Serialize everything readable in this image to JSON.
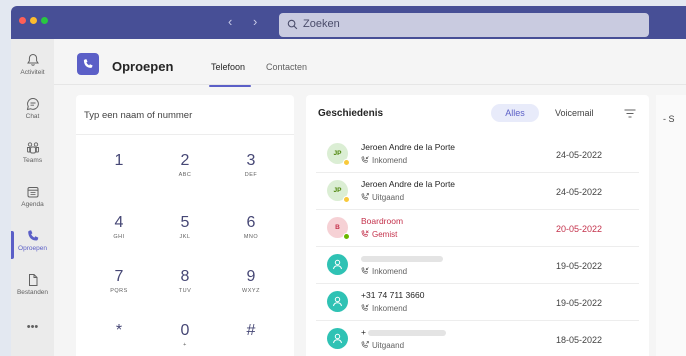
{
  "titlebar": {
    "search_placeholder": "Zoeken",
    "back_icon": "chevron-left-icon",
    "forward_icon": "chevron-right-icon"
  },
  "rail": {
    "items": [
      {
        "label": "Activiteit",
        "icon": "bell-icon"
      },
      {
        "label": "Chat",
        "icon": "chat-icon"
      },
      {
        "label": "Teams",
        "icon": "teams-icon"
      },
      {
        "label": "Agenda",
        "icon": "calendar-icon"
      },
      {
        "label": "Oproepen",
        "icon": "phone-icon",
        "active": true
      },
      {
        "label": "Bestanden",
        "icon": "file-icon"
      }
    ],
    "more": "•••"
  },
  "header": {
    "title": "Oproepen",
    "tabs": [
      {
        "label": "Telefoon",
        "active": true
      },
      {
        "label": "Contacten",
        "active": false
      }
    ]
  },
  "dialpad": {
    "placeholder": "Typ een naam of nummer",
    "keys": [
      {
        "digit": "1",
        "letters": ""
      },
      {
        "digit": "2",
        "letters": "ABC"
      },
      {
        "digit": "3",
        "letters": "DEF"
      },
      {
        "digit": "4",
        "letters": "GHI"
      },
      {
        "digit": "5",
        "letters": "JKL"
      },
      {
        "digit": "6",
        "letters": "MNO"
      },
      {
        "digit": "7",
        "letters": "PQRS"
      },
      {
        "digit": "8",
        "letters": "TUV"
      },
      {
        "digit": "9",
        "letters": "WXYZ"
      },
      {
        "digit": "*",
        "letters": ""
      },
      {
        "digit": "0",
        "letters": "+"
      },
      {
        "digit": "#",
        "letters": ""
      }
    ]
  },
  "history": {
    "title": "Geschiedenis",
    "filters": {
      "all": "Alles",
      "voicemail": "Voicemail"
    },
    "rows": [
      {
        "initials": "JP",
        "name": "Jeroen Andre de la Porte",
        "type": "Inkomend",
        "date": "24-05-2022",
        "avatar_bg": "#dbeed4",
        "avatar_fg": "#498205",
        "presence": "#f8c93b"
      },
      {
        "initials": "JP",
        "name": "Jeroen Andre de la Porte",
        "type": "Uitgaand",
        "date": "24-05-2022",
        "avatar_bg": "#dbeed4",
        "avatar_fg": "#498205",
        "presence": "#f8c93b"
      },
      {
        "initials": "B",
        "name": "Boardroom",
        "type": "Gemist",
        "date": "20-05-2022",
        "avatar_bg": "#f6d1d5",
        "avatar_fg": "#c4314b",
        "presence": "#6bb700",
        "missed": true
      },
      {
        "initials": "",
        "name": "",
        "type": "Inkomend",
        "date": "19-05-2022",
        "avatar_bg": "#2fc2b4",
        "presence": ""
      },
      {
        "initials": "",
        "name": "+31 74 711 3660",
        "type": "Inkomend",
        "date": "19-05-2022",
        "avatar_bg": "#2fc2b4",
        "presence": ""
      },
      {
        "initials": "",
        "name": "+",
        "type": "Uitgaand",
        "date": "18-05-2022",
        "avatar_bg": "#2fc2b4",
        "presence": ""
      }
    ]
  },
  "right_panel": {
    "text": "- S"
  }
}
